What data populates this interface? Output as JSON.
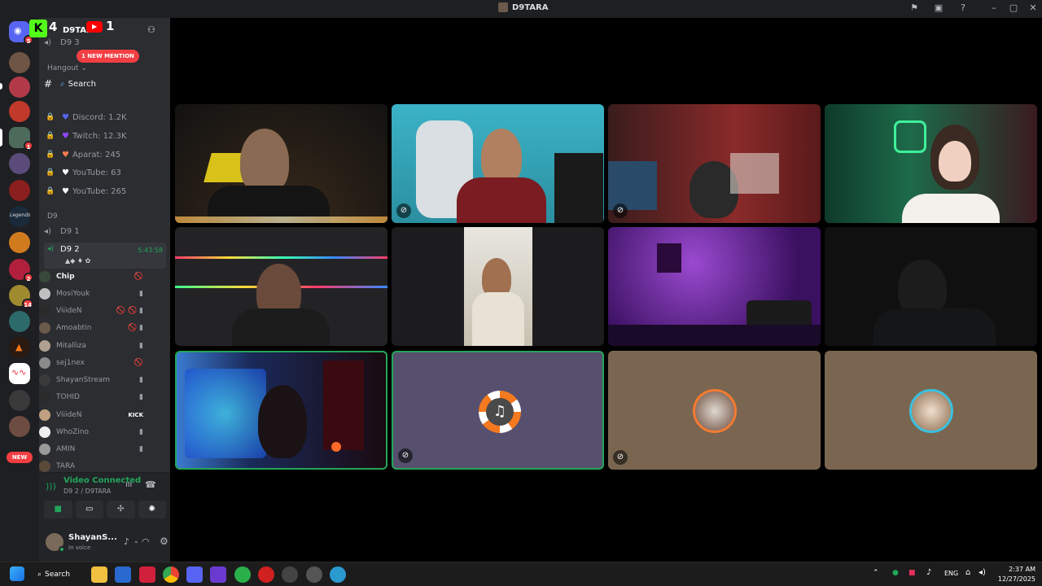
{
  "window": {
    "title": "D9TARA"
  },
  "rail": {
    "home_badge": "5",
    "servers": [
      {
        "name": "server-1",
        "badge": ""
      },
      {
        "name": "server-2",
        "badge": ""
      },
      {
        "name": "server-3",
        "badge": ""
      },
      {
        "name": "server-4",
        "badge": "1"
      },
      {
        "name": "server-5",
        "badge": ""
      },
      {
        "name": "server-6",
        "badge": ""
      },
      {
        "name": "server-legends",
        "badge": ""
      },
      {
        "name": "server-8",
        "badge": ""
      },
      {
        "name": "server-9",
        "badge": "2"
      },
      {
        "name": "server-10",
        "badge": "14"
      },
      {
        "name": "server-11",
        "badge": ""
      },
      {
        "name": "server-12",
        "badge": ""
      },
      {
        "name": "server-13",
        "badge": ""
      },
      {
        "name": "server-14",
        "badge": ""
      },
      {
        "name": "server-15",
        "badge": ""
      }
    ],
    "new_label": "NEW"
  },
  "overlay": {
    "kick_count": "4",
    "youtube_count": "1"
  },
  "server": {
    "name": "D9TARA",
    "partial_channel": "D9 3"
  },
  "mention_badge": "1 NEW MENTION",
  "categories": {
    "hangout": "Hangout",
    "d9": "D9"
  },
  "search_channel": "Search",
  "stat_channels": [
    {
      "label": "Discord: 1.2K"
    },
    {
      "label": "Twitch: 12.3K"
    },
    {
      "label": "Aparat: 245"
    },
    {
      "label": "YouTube: 63"
    },
    {
      "label": "YouTube: 265"
    }
  ],
  "voice_channels": [
    {
      "label": "D9 1"
    },
    {
      "label": "D9 2",
      "timer": "5:43:58"
    }
  ],
  "voice_users": [
    {
      "name": "Chip",
      "icons": "🚫"
    },
    {
      "name": "MosiYouk",
      "icons": "▮"
    },
    {
      "name": "ViiideN",
      "icons": "🚫 🚫 ▮"
    },
    {
      "name": "Amoabtin",
      "icons": "🚫 ▮"
    },
    {
      "name": "Mitalliza",
      "icons": "▮"
    },
    {
      "name": "sej1nex",
      "icons": "🚫"
    },
    {
      "name": "ShayanStream",
      "icons": "▮"
    },
    {
      "name": "TOHID",
      "icons": "▮"
    },
    {
      "name": "ViiideN",
      "icons": "KICK"
    },
    {
      "name": "WhoZino",
      "icons": "▮"
    },
    {
      "name": "AMIN",
      "icons": "▮"
    },
    {
      "name": "TARA",
      "icons": ""
    }
  ],
  "voice_status": {
    "title": "Video Connected",
    "subtitle": "D9 2 / D9TARA"
  },
  "user": {
    "name": "ShayanS...",
    "status": "In voice"
  },
  "taskbar": {
    "search": "Search",
    "lang": "ENG",
    "time": "2:37 AM",
    "date": "12/27/2025"
  },
  "colors": {
    "green": "#23a55a",
    "red": "#f23f43",
    "discord_blurple": "#5865f2"
  }
}
